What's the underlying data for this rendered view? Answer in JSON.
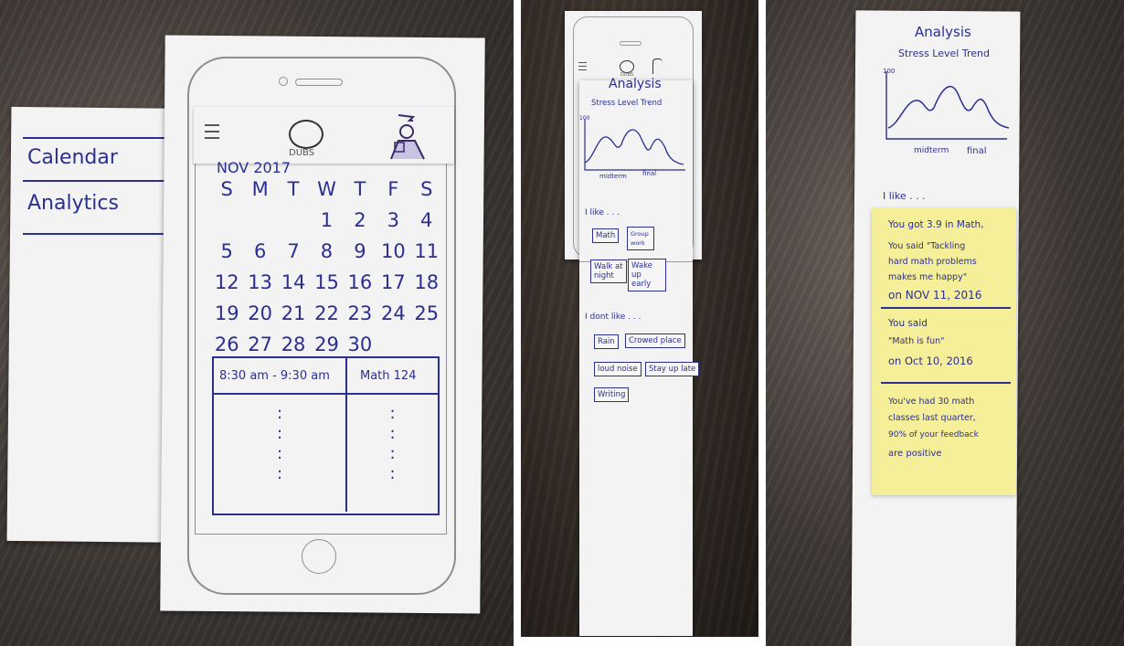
{
  "panel1": {
    "menu_items": [
      "Calendar",
      "Analytics"
    ],
    "app_logo": "DUBS",
    "month_label": "NOV 2017",
    "weekdays": [
      "S",
      "M",
      "T",
      "W",
      "T",
      "F",
      "S"
    ],
    "weeks": [
      [
        "",
        "",
        "",
        "1",
        "2",
        "3",
        "4"
      ],
      [
        "5",
        "6",
        "7",
        "8",
        "9",
        "10",
        "11"
      ],
      [
        "12",
        "13",
        "14",
        "15",
        "16",
        "17",
        "18"
      ],
      [
        "19",
        "20",
        "21",
        "22",
        "23",
        "24",
        "25"
      ],
      [
        "26",
        "27",
        "28",
        "29",
        "30",
        "",
        ""
      ]
    ],
    "event": {
      "time": "8:30 am - 9:30 am",
      "title": "Math 124",
      "filler": ":"
    }
  },
  "panel2": {
    "logo_text": "DUBS",
    "title": "Analysis",
    "chart_title": "Stress Level Trend",
    "chart_y_max": "100",
    "chart_x_labels": [
      "midterm",
      "final"
    ],
    "likes_heading": "I like . . .",
    "likes": [
      "Math",
      "Group work",
      "Walk at night",
      "Wake up early"
    ],
    "dislikes_heading": "I dont like . . .",
    "dislikes": [
      "Rain",
      "Crowed place",
      "loud noise",
      "Stay up late",
      "Writing"
    ]
  },
  "panel3": {
    "title": "Analysis",
    "chart_title": "Stress Level Trend",
    "chart_y_max": "100",
    "chart_x_labels": [
      "midterm",
      "final"
    ],
    "likes_heading": "I like . . .",
    "note1": {
      "line1": "You got 3.9 in Math,",
      "line2": "You said \"Tackling",
      "line3": "hard math problems",
      "line4": "makes me happy\"",
      "line5": "on NOV 11, 2016"
    },
    "note2": {
      "line1": "You said",
      "line2": "\"Math is fun\"",
      "line3": "on Oct 10, 2016"
    },
    "note3": {
      "line1": "You've had 30 math",
      "line2": "classes last quarter,",
      "line3": "90% of your feedback",
      "line4": "are positive"
    }
  },
  "colors": {
    "ink": "#2b2f8f",
    "sticky": "#f6ef9a",
    "paper": "#f3f3f4"
  },
  "icons": [
    "menu-icon",
    "logo-icon",
    "profile-icon",
    "home-button-icon"
  ]
}
